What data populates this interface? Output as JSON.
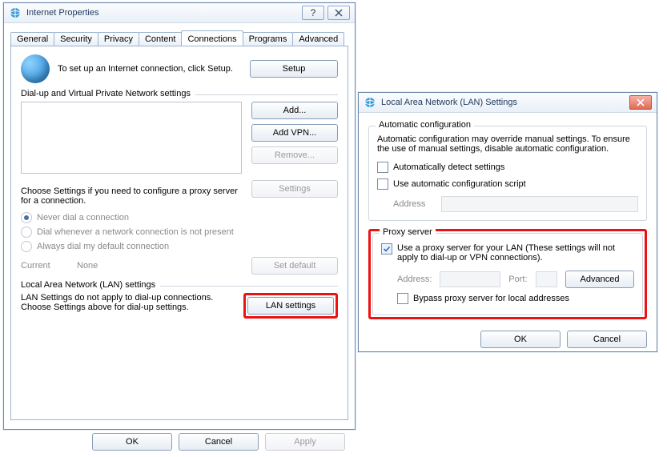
{
  "win1": {
    "title": "Internet Properties",
    "tabs": [
      "General",
      "Security",
      "Privacy",
      "Content",
      "Connections",
      "Programs",
      "Advanced"
    ],
    "active_tab": "Connections",
    "setup": {
      "text": "To set up an Internet connection, click Setup.",
      "btn": "Setup"
    },
    "dvp": {
      "legend": "Dial-up and Virtual Private Network settings",
      "add": "Add...",
      "add_vpn": "Add VPN...",
      "remove": "Remove...",
      "settings": "Settings",
      "note": "Choose Settings if you need to configure a proxy server for a connection.",
      "radios": {
        "never": "Never dial a connection",
        "when_absent": "Dial whenever a network connection is not present",
        "always": "Always dial my default connection"
      },
      "current_label": "Current",
      "current_value": "None",
      "set_default": "Set default"
    },
    "lan": {
      "legend": "Local Area Network (LAN) settings",
      "note": "LAN Settings do not apply to dial-up connections. Choose Settings above for dial-up settings.",
      "btn": "LAN settings"
    },
    "footer": {
      "ok": "OK",
      "cancel": "Cancel",
      "apply": "Apply"
    }
  },
  "win2": {
    "title": "Local Area Network (LAN) Settings",
    "auto": {
      "legend": "Automatic configuration",
      "note": "Automatic configuration may override manual settings.  To ensure the use of manual settings, disable automatic configuration.",
      "detect": "Automatically detect settings",
      "script": "Use automatic configuration script",
      "address_label": "Address"
    },
    "proxy": {
      "legend": "Proxy server",
      "use": "Use a proxy server for your LAN (These settings will not apply to dial-up or VPN connections).",
      "address_label": "Address:",
      "port_label": "Port:",
      "advanced": "Advanced",
      "bypass": "Bypass proxy server for local addresses"
    },
    "footer": {
      "ok": "OK",
      "cancel": "Cancel"
    }
  }
}
